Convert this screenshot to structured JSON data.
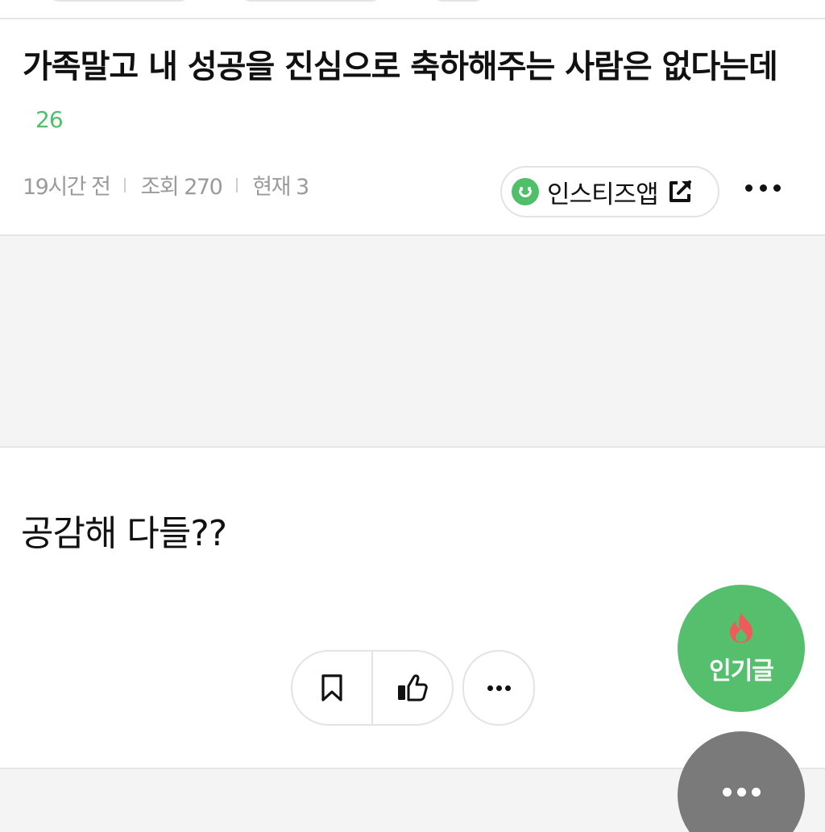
{
  "post": {
    "title": "가족말고 내 성공을 진심으로 축하해주는 사람은 없다는데",
    "comment_count": "26",
    "time": "19시간 전",
    "views": "조회 270",
    "current": "현재 3",
    "body": "공감해 다들??"
  },
  "app_link": {
    "label": "인스티즈앱",
    "icon": "external-link-icon"
  },
  "actions": {
    "bookmark_icon": "bookmark-icon",
    "like_icon": "thumbs-up-icon",
    "more_icon": "more-dots-icon"
  },
  "fab": {
    "popular_label": "인기글",
    "popular_icon": "fire-icon",
    "more_icon": "more-dots-icon"
  },
  "colors": {
    "accent_green": "#4fbf6a",
    "fab_green": "#55bf6e",
    "fab_gray": "#7a7a7a",
    "fire": "#ef5b5b"
  }
}
